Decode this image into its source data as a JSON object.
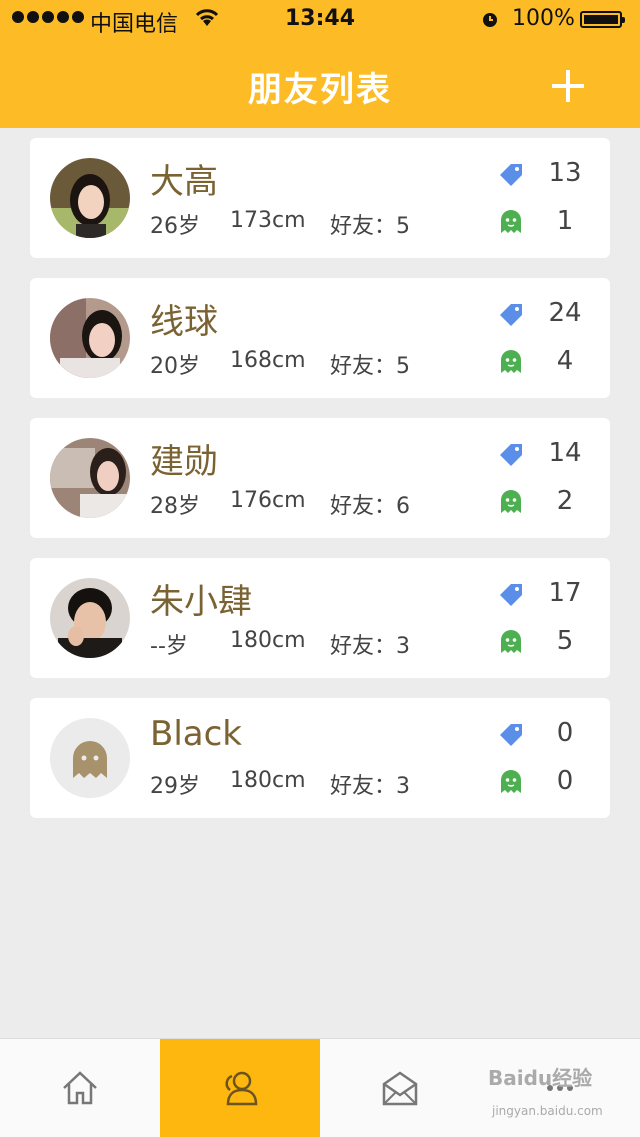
{
  "status_bar": {
    "carrier": "中国电信",
    "time": "13:44",
    "battery": "100%"
  },
  "header": {
    "title": "朋友列表",
    "add_icon": "plus-icon"
  },
  "friends": [
    {
      "name": "大高",
      "age": "26岁",
      "height": "173cm",
      "friends": "好友：5",
      "tags": "13",
      "ghosts": "1"
    },
    {
      "name": "线球",
      "age": "20岁",
      "height": "168cm",
      "friends": "好友：5",
      "tags": "24",
      "ghosts": "4"
    },
    {
      "name": "建勋",
      "age": "28岁",
      "height": "176cm",
      "friends": "好友：6",
      "tags": "14",
      "ghosts": "2"
    },
    {
      "name": "朱小肆",
      "age": "--岁",
      "height": "180cm",
      "friends": "好友：3",
      "tags": "17",
      "ghosts": "5"
    },
    {
      "name": "Black",
      "age": "29岁",
      "height": "180cm",
      "friends": "好友：3",
      "tags": "0",
      "ghosts": "0"
    }
  ],
  "tabbar": {
    "items": [
      "home-icon",
      "friends-icon",
      "mail-icon",
      "more-icon"
    ],
    "active": "friends-icon"
  },
  "watermark": {
    "text": "Baidu经验",
    "sub": "jingyan.baidu.com"
  },
  "colors": {
    "header": "#fdbb25",
    "name": "#7a6232",
    "tag": "#5b8ee8",
    "ghost": "#4caf50",
    "active_tab": "#fdb70e"
  }
}
